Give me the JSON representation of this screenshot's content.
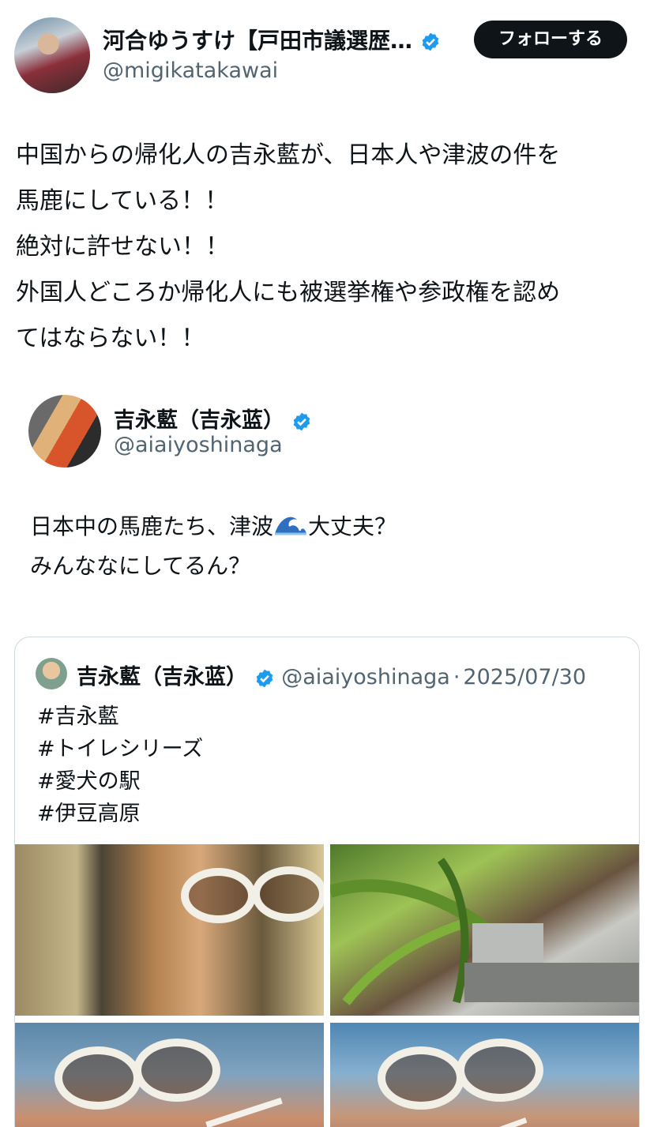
{
  "tweet": {
    "author_name": "河合ゆうすけ【戸田市議選歴…",
    "author_handle": "@migikatakawai",
    "follow_label": "フォローする",
    "text": "中国からの帰化人の吉永藍が、日本人や津波の件を\n馬鹿にしている！！\n絶対に許せない！！\n外国人どころか帰化人にも被選挙権や参政権を認め\nてはならない！！"
  },
  "quoted": {
    "author_name": "吉永藍（吉永蓝）",
    "author_handle": "@aiaiyoshinaga",
    "text_part1": "日本中の馬鹿たち、津波",
    "emoji_name": "wave-emoji",
    "text_part2": "大丈夫？\nみんななにしてるん？"
  },
  "card": {
    "author_name": "吉永藍（吉永蓝）",
    "author_handle": "@aiaiyoshinaga",
    "separator": "·",
    "date": "2025/07/30",
    "tags": [
      "#吉永藍",
      "#トイレシリーズ",
      "#愛犬の駅",
      "#伊豆高原"
    ]
  },
  "colors": {
    "verified": "#1d9bf0",
    "text": "#0f1419",
    "secondary": "#536471",
    "border": "#cfd9de",
    "follow_bg": "#0f1419"
  }
}
